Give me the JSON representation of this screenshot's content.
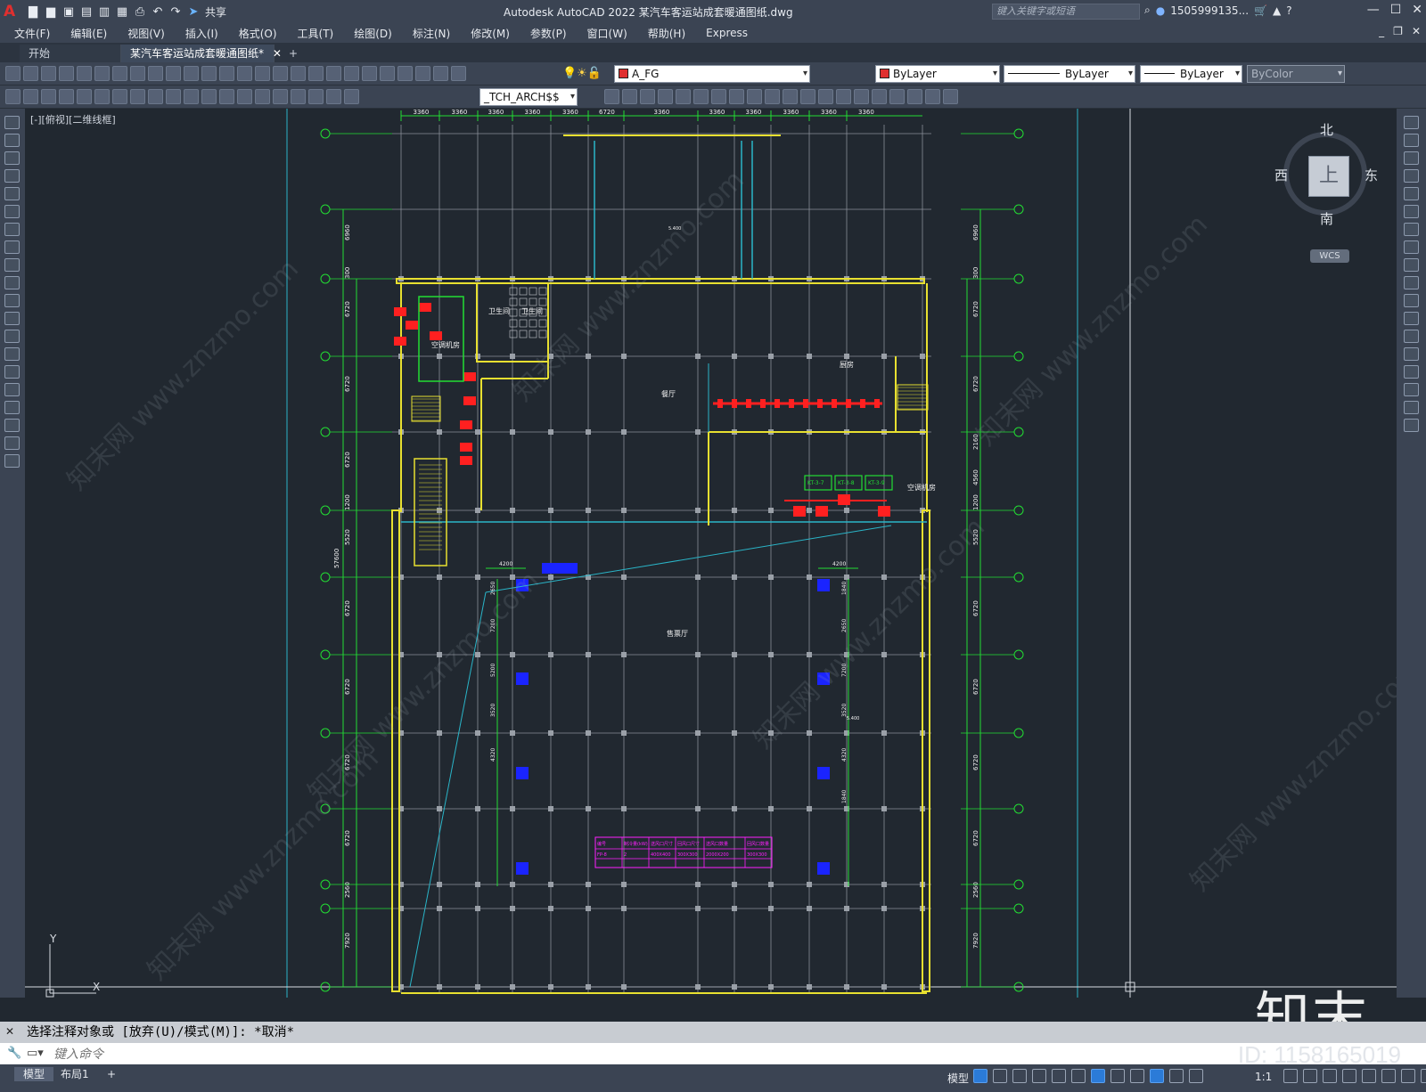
{
  "titlebar": {
    "app_letter": "A",
    "title": "Autodesk AutoCAD 2022    某汽车客运站成套暖通图纸.dwg",
    "share_label": "共享",
    "search_placeholder": "键入关键字或短语",
    "user": "1505999135...",
    "help": "?"
  },
  "menu": [
    "文件(F)",
    "编辑(E)",
    "视图(V)",
    "插入(I)",
    "格式(O)",
    "工具(T)",
    "绘图(D)",
    "标注(N)",
    "修改(M)",
    "参数(P)",
    "窗口(W)",
    "帮助(H)",
    "Express"
  ],
  "tabs": [
    {
      "label": "开始"
    },
    {
      "label": "某汽车客运站成套暖通图纸*"
    }
  ],
  "toolbar1": {
    "layer": "A_FG",
    "color": "ByLayer",
    "linetype": "ByLayer",
    "lineweight": "ByLayer",
    "plotstyle": "ByColor"
  },
  "toolbar2": {
    "style": "_TCH_ARCH$$"
  },
  "viewport": {
    "label": "[-][俯视][二维线框]"
  },
  "viewcube": {
    "north": "北",
    "south": "南",
    "west": "西",
    "east": "东",
    "face": "上",
    "wcs": "WCS"
  },
  "drawing": {
    "dims_top": [
      "3360",
      "3360",
      "3360",
      "3360",
      "3360",
      "6720",
      "3360",
      "3360",
      "3360",
      "3360",
      "3360",
      "3360"
    ],
    "dims_left": [
      "6960",
      "300",
      "6720",
      "6720",
      "6720",
      "1200",
      "5520",
      "6720",
      "6720",
      "6720",
      "6720",
      "2560",
      "7920"
    ],
    "dims_right": [
      "6960",
      "300",
      "6720",
      "6720",
      "2160",
      "4560",
      "1200",
      "5520",
      "6720",
      "6720",
      "6720",
      "6720",
      "2560",
      "7920"
    ],
    "axis_left_total": "57600",
    "room_labels": {
      "wc1": "卫生间",
      "wc2": "卫生间",
      "ac_room1": "空调机房",
      "kitchen": "厨房",
      "restaurant": "餐厅",
      "ac_room2": "空调机房",
      "waiting": "售票厅"
    },
    "small_dims": [
      "4200",
      "4200",
      "2650",
      "7200",
      "5200",
      "3520",
      "4320",
      "1840",
      "2650",
      "7200",
      "3520",
      "4320",
      "1840",
      "5.400",
      "5.400"
    ],
    "ac_labels": [
      "KT-3-7",
      "KT-3-8",
      "KT-3-9"
    ],
    "table": {
      "headers": [
        "编号",
        "制冷量(kW)",
        "送风口尺寸",
        "回风口尺寸",
        "送风口数量",
        "回风口数量"
      ],
      "row": [
        "FP-8",
        "2",
        "400X400",
        "300X300",
        "2000X200",
        "300X300"
      ]
    },
    "ucs": {
      "x": "X",
      "y": "Y"
    }
  },
  "command": {
    "history": "选择注释对象或 [放弃(U)/模式(M)]: *取消*",
    "placeholder": "键入命令"
  },
  "statusbar": {
    "layouts": [
      "模型",
      "布局1",
      "+"
    ],
    "model": "模型",
    "scale": "1:1"
  },
  "watermark": {
    "brand": "知末",
    "id": "ID: 1158165019",
    "site": "知末网 www.znzmo.com"
  },
  "colors": {
    "accent_red": "#e02f2f",
    "grid_line": "#8a8f98",
    "wall_yellow": "#e8e030",
    "dim_green": "#22dd33",
    "cyan": "#2ab5c8",
    "equip_red": "#ff2020",
    "equip_blue": "#1a24ff",
    "table_magenta": "#ff20ff"
  }
}
